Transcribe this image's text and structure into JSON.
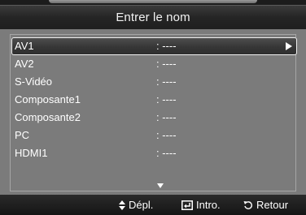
{
  "title": "Entrer le nom",
  "items": [
    {
      "label": "AV1",
      "value": ": ----",
      "selected": true
    },
    {
      "label": "AV2",
      "value": ": ----"
    },
    {
      "label": "S-Vidéo",
      "value": ": ----"
    },
    {
      "label": "Composante1",
      "value": ": ----"
    },
    {
      "label": "Composante2",
      "value": ": ----"
    },
    {
      "label": "PC",
      "value": ": ----"
    },
    {
      "label": "HDMI1",
      "value": ": ----"
    }
  ],
  "footer": {
    "move": {
      "icon": "up-down-arrows-icon",
      "label": "Dépl."
    },
    "enter": {
      "icon": "enter-icon",
      "label": "Intro."
    },
    "return": {
      "icon": "return-icon",
      "label": "Retour"
    }
  },
  "colors": {
    "panel": "#7b7b7b",
    "title_bar": "#252525",
    "text": "#ffffff"
  }
}
